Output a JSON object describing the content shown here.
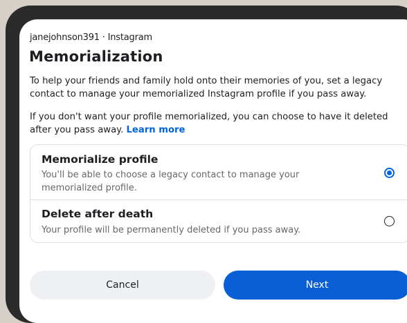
{
  "header": {
    "account": "janejohnson391 · Instagram",
    "title": "Memorialization"
  },
  "body": {
    "paragraph1": "To help your friends and family hold onto their memories of you, set a legacy contact to manage your memorialized Instagram profile if you pass away.",
    "paragraph2": "If you don't want your profile memorialized, you can choose to have it deleted after you pass away.",
    "learn_more": "Learn more"
  },
  "options": [
    {
      "title": "Memorialize profile",
      "description": "You'll be able to choose a legacy contact to manage your memorialized profile.",
      "selected": true
    },
    {
      "title": "Delete after death",
      "description": "Your profile will be permanently deleted if you pass away.",
      "selected": false
    }
  ],
  "buttons": {
    "cancel": "Cancel",
    "next": "Next"
  },
  "colors": {
    "accent": "#0064e0",
    "primary_button": "#0a5ed6",
    "secondary_button": "#eef0f3",
    "text": "#1c1e21",
    "muted_text": "#65676b"
  }
}
